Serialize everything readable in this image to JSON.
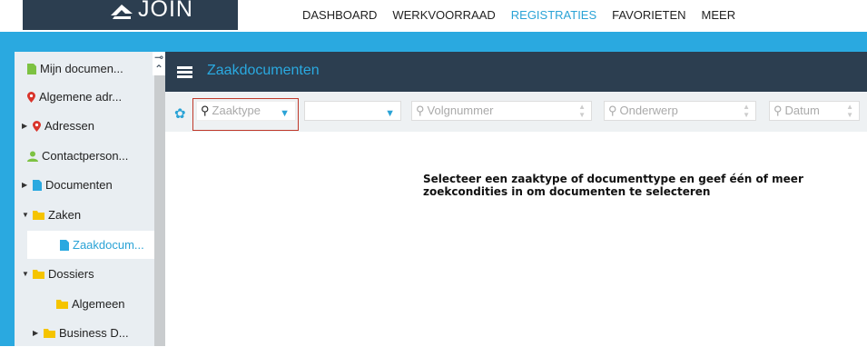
{
  "app": {
    "logo_text": "JOIN"
  },
  "nav": [
    {
      "label": "DASHBOARD"
    },
    {
      "label": "WERKVOORRAAD"
    },
    {
      "label": "REGISTRATIES",
      "active": true
    },
    {
      "label": "FAVORIETEN"
    },
    {
      "label": "MEER"
    }
  ],
  "sidebar": {
    "items": [
      {
        "label": "Mijn documen...",
        "icon": "document-icon"
      },
      {
        "label": "Algemene adr...",
        "icon": "location-pin-icon"
      },
      {
        "label": "Adressen",
        "icon": "location-pin-icon"
      },
      {
        "label": "Contactperson...",
        "icon": "person-icon"
      },
      {
        "label": "Documenten",
        "icon": "document-icon"
      },
      {
        "label": "Zaken",
        "icon": "folder-icon"
      },
      {
        "label": "Zaakdocum...",
        "icon": "document-icon"
      },
      {
        "label": "Dossiers",
        "icon": "folder-icon"
      },
      {
        "label": "Algemeen",
        "icon": "folder-icon"
      },
      {
        "label": "Business D...",
        "icon": "folder-icon"
      }
    ]
  },
  "main": {
    "title": "Zaakdocumenten",
    "filters": {
      "zaaktype_placeholder": "Zaaktype",
      "volgnummer_placeholder": "Volgnummer",
      "onderwerp_placeholder": "Onderwerp",
      "datum_placeholder": "Datum"
    },
    "message": "Selecteer een zaaktype of documenttype en geef één of meer zoekcondities in om documenten te selecteren"
  },
  "colors": {
    "accent": "#2aa9e0",
    "header": "#2c3e50",
    "doc": "#7dc242",
    "folder": "#f5c400",
    "pin": "#d9342b"
  }
}
